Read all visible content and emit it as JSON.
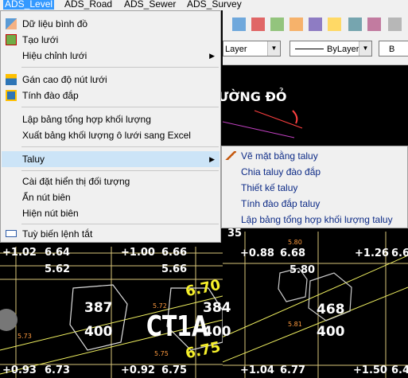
{
  "menubar": {
    "items": [
      "ADS_Level",
      "ADS_Road",
      "ADS_Sewer",
      "ADS_Survey"
    ]
  },
  "toolbar": {
    "layer_combo": "Layer",
    "linetype_combo": "ByLayer",
    "third_combo": "B"
  },
  "menu": {
    "items": [
      {
        "label": "Dữ liệu bình đồ"
      },
      {
        "label": "Tạo lưới"
      },
      {
        "label": "Hiệu chỉnh lưới"
      },
      {
        "label": "Gán cao độ nút lưới"
      },
      {
        "label": "Tính đào đắp"
      },
      {
        "label": "Lập bảng tổng hợp khối lượng"
      },
      {
        "label": "Xuất bảng khối lượng ô lưới sang Excel"
      },
      {
        "label": "Taluy"
      },
      {
        "label": "Cài đặt hiển thị đối tượng"
      },
      {
        "label": "Ẩn nút biên"
      },
      {
        "label": "Hiện nút biên"
      },
      {
        "label": "Tuỳ biến lệnh tắt"
      }
    ]
  },
  "submenu": {
    "items": [
      {
        "label": "Vẽ mặt bằng taluy"
      },
      {
        "label": "Chia taluy đào đắp"
      },
      {
        "label": "Thiết kế taluy"
      },
      {
        "label": "Tính đào đắp taluy"
      },
      {
        "label": "Lập bảng tổng hợp khối lượng taluy"
      }
    ]
  },
  "cad": {
    "road_title": "ƯỜNG ĐỎ",
    "row1": [
      "+1.02",
      "6.64",
      "+1.00",
      "6.66",
      "+0.88",
      "6.68",
      "+1.26",
      "6.6"
    ],
    "row2": [
      "5.62",
      "5.66",
      "5.80"
    ],
    "cells": [
      "387",
      "400",
      "384",
      "400",
      "468",
      "400"
    ],
    "yellow": [
      "6.70",
      "6.75"
    ],
    "ct": "CT1A",
    "row_bottom": [
      "+0.93",
      "6.73",
      "+0.92",
      "6.75",
      "+1.04",
      "6.77",
      "+1.50",
      "6.4"
    ],
    "small_orange": [
      "5.80",
      "5.81",
      "5.72",
      "5.73",
      "5.75"
    ],
    "partial": "35"
  }
}
